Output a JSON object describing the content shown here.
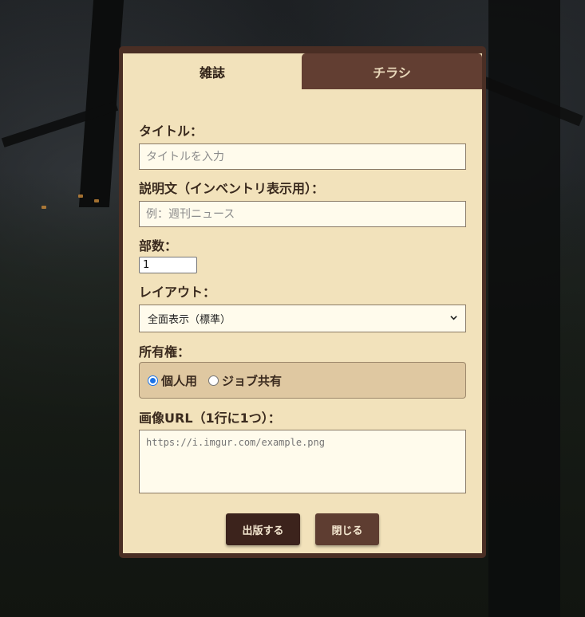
{
  "tabs": [
    {
      "label": "雑誌",
      "active": true
    },
    {
      "label": "チラシ",
      "active": false
    }
  ],
  "form": {
    "title": {
      "label": "タイトル：",
      "value": "",
      "placeholder": "タイトルを入力"
    },
    "description": {
      "label": "説明文（インベントリ表示用）：",
      "value": "",
      "placeholder": "例：週刊ニュース"
    },
    "copies": {
      "label": "部数：",
      "value": "1"
    },
    "layout": {
      "label": "レイアウト：",
      "selected": "全面表示（標準）",
      "icon": "chevron-down-icon"
    },
    "ownership": {
      "label": "所有権：",
      "options": [
        {
          "label": "個人用",
          "checked": true
        },
        {
          "label": "ジョブ共有",
          "checked": false
        }
      ]
    },
    "images": {
      "label": "画像URL（1行に1つ）：",
      "value": "",
      "placeholder": "https://i.imgur.com/example.png"
    }
  },
  "buttons": {
    "publish": "出版する",
    "close": "閉じる"
  },
  "colors": {
    "panel": "#f2e2bb",
    "frame": "#4a2e24",
    "inactive_tab": "#623e32",
    "publish_button": "#3c231c",
    "close_button": "#5e3d31",
    "ownership_box": "#dfc8a1",
    "radio_accent": "#1a73e8"
  }
}
